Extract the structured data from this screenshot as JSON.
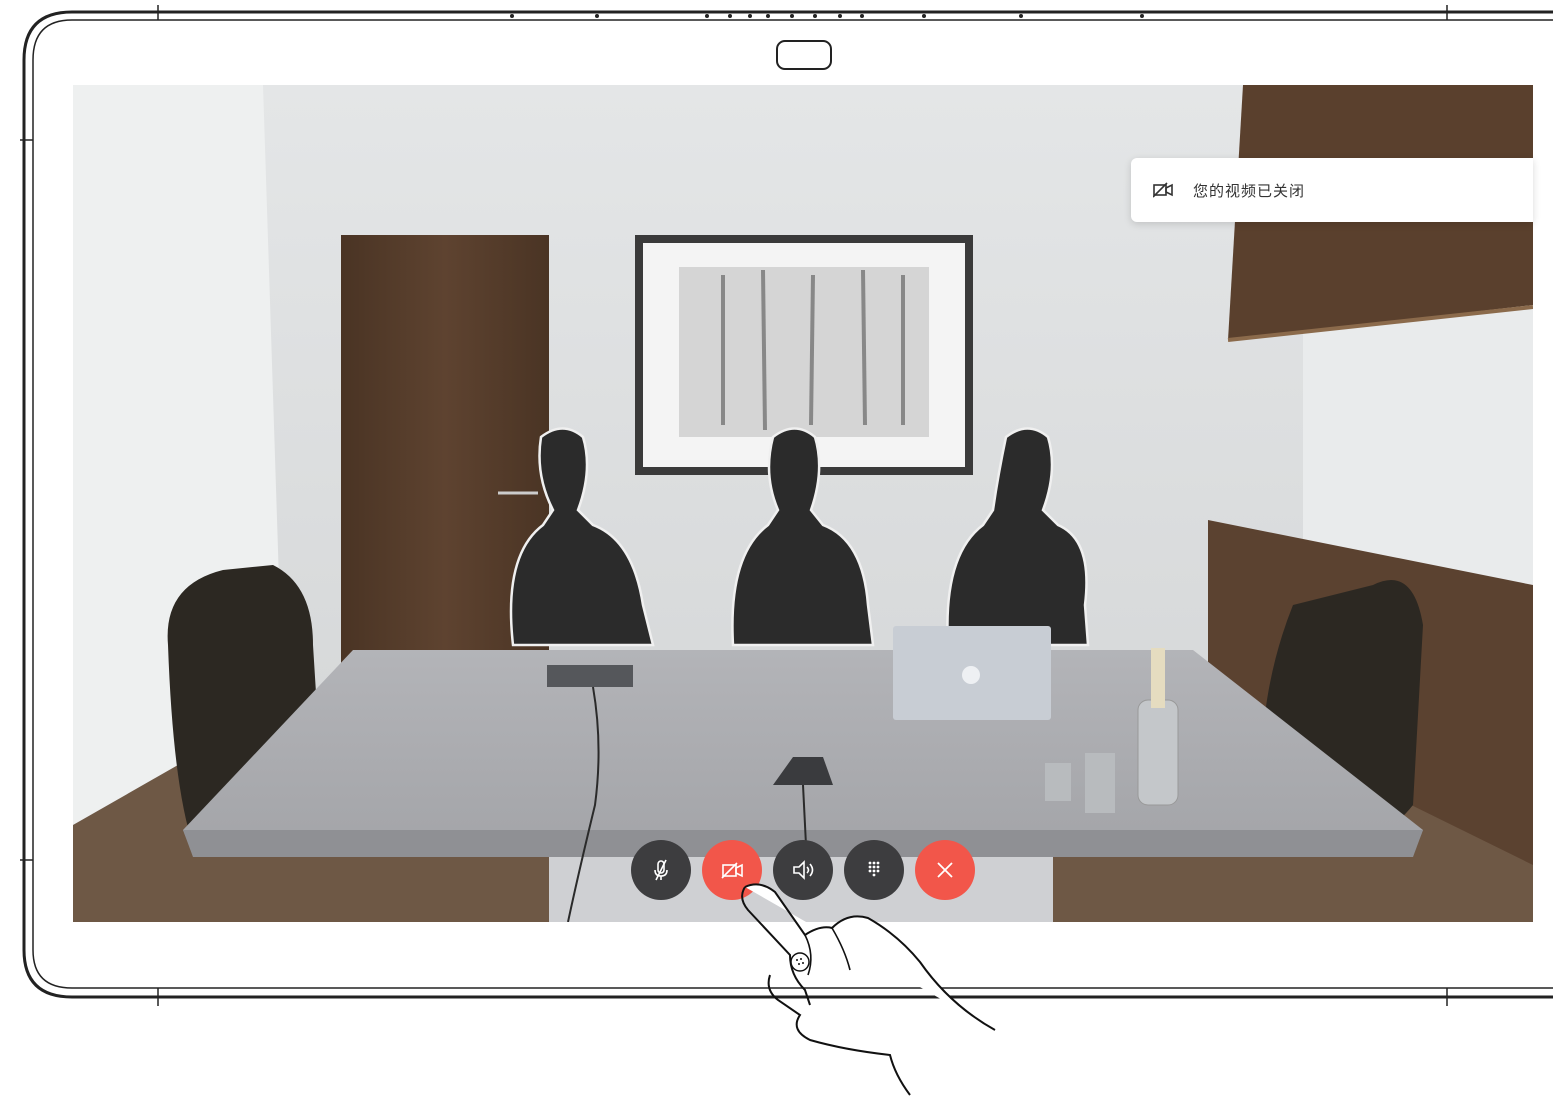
{
  "notification": {
    "icon": "video-off-icon",
    "text": "您的视频已关闭"
  },
  "call_controls": [
    {
      "name": "mute-microphone-button",
      "icon": "microphone-muted-icon",
      "state": "default",
      "color": "#3d3d3f"
    },
    {
      "name": "video-toggle-button",
      "icon": "video-off-icon",
      "state": "active",
      "color": "#f2564a"
    },
    {
      "name": "volume-button",
      "icon": "speaker-icon",
      "state": "default",
      "color": "#3d3d3f"
    },
    {
      "name": "keypad-button",
      "icon": "keypad-icon",
      "state": "default",
      "color": "#3d3d3f"
    },
    {
      "name": "end-call-button",
      "icon": "close-icon",
      "state": "end",
      "color": "#f2564a"
    }
  ],
  "colors": {
    "accent_red": "#f2564a",
    "button_dark": "#3d3d3f",
    "device_outline": "#222222"
  }
}
